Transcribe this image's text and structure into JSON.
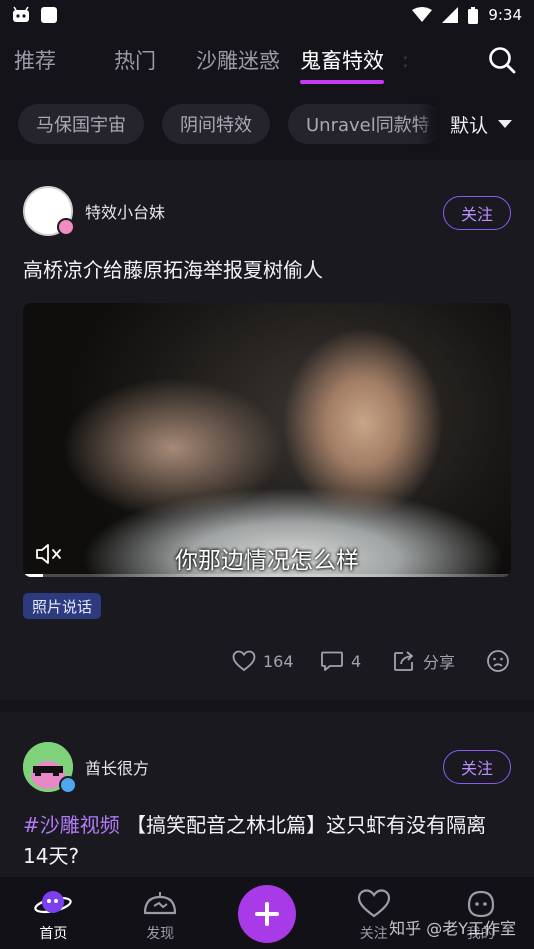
{
  "status_bar": {
    "time": "9:34"
  },
  "top_tabs": [
    {
      "label": "推荐",
      "active": false
    },
    {
      "label": "热门",
      "active": false
    },
    {
      "label": "沙雕迷惑",
      "active": false
    },
    {
      "label": "鬼畜特效",
      "active": true
    },
    {
      "label": ":",
      "active": false
    }
  ],
  "filter_chips": [
    "马保国宇宙",
    "阴间特效",
    "Unravel同款特"
  ],
  "sort": {
    "label": "默认"
  },
  "posts": [
    {
      "author": "特效小台妹",
      "follow_label": "关注",
      "title": "高桥凉介给藤原拓海举报夏树偷人",
      "video_subtitle": "你那边情况怎么样",
      "video_progress": 0.04,
      "tag": "照片说话",
      "likes": "164",
      "comments": "4",
      "share_label": "分享"
    },
    {
      "author": "酋长很方",
      "follow_label": "关注",
      "hashtag": "#沙雕视频",
      "title": "【搞笑配音之林北篇】这只虾有没有隔离14天?"
    }
  ],
  "bottom_nav": [
    {
      "label": "首页",
      "icon": "home-planet-icon",
      "active": true
    },
    {
      "label": "发现",
      "icon": "discover-icon",
      "active": false
    },
    {
      "label": "",
      "icon": "plus-icon",
      "active": false
    },
    {
      "label": "关注",
      "icon": "heart-icon",
      "active": false
    },
    {
      "label": "我的",
      "icon": "profile-face-icon",
      "active": false
    }
  ],
  "watermark": "知乎 @老Y工作室",
  "colors": {
    "accent": "#c43af2",
    "follow_border": "#8b5ef0",
    "hashtag": "#b07cf5",
    "tag_bg": "#2d3a7e",
    "plus_button": "#a93ae8"
  }
}
